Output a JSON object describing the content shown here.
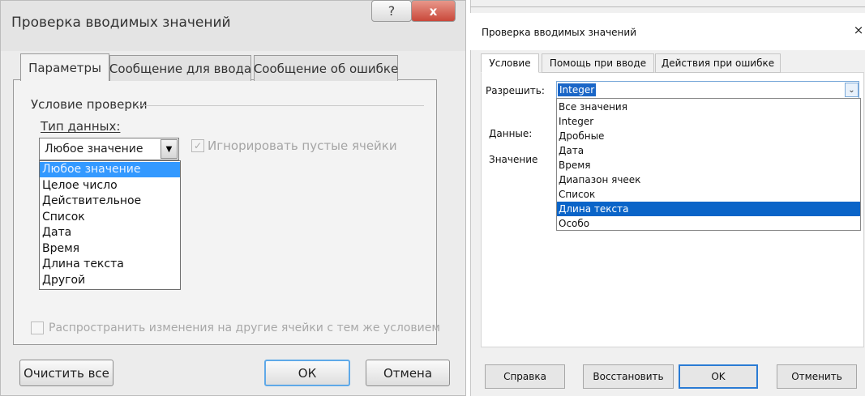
{
  "left_dialog": {
    "title": "Проверка вводимых значений",
    "help_icon": "?",
    "close_icon": "x",
    "tabs": [
      {
        "label": "Параметры"
      },
      {
        "label": "Сообщение для ввода"
      },
      {
        "label": "Сообщение об ошибке"
      }
    ],
    "group_title": "Условие проверки",
    "data_type_label": "Тип данных:",
    "data_type_value": "Любое значение",
    "ignore_blank_label": "Игнорировать пустые ячейки",
    "options": [
      {
        "label": "Любое значение"
      },
      {
        "label": "Целое число"
      },
      {
        "label": "Действительное"
      },
      {
        "label": "Список"
      },
      {
        "label": "Дата"
      },
      {
        "label": "Время"
      },
      {
        "label": "Длина текста"
      },
      {
        "label": "Другой"
      }
    ],
    "selected_option": "Любое значение",
    "spread_changes_label": "Распространить изменения на другие ячейки с тем же условием",
    "buttons": {
      "clear": "Очистить все",
      "ok": "ОК",
      "cancel": "Отмена"
    }
  },
  "right_dialog": {
    "title": "Проверка вводимых значений",
    "close_icon": "×",
    "tabs": [
      {
        "label": "Условие"
      },
      {
        "label": "Помощь при вводе"
      },
      {
        "label": "Действия при ошибке"
      }
    ],
    "allow_label": "Разрешить:",
    "allow_value": "Integer",
    "data_label": "Данные:",
    "value_label": "Значение",
    "options": [
      {
        "label": "Все значения"
      },
      {
        "label": "Integer"
      },
      {
        "label": "Дробные"
      },
      {
        "label": "Дата"
      },
      {
        "label": "Время"
      },
      {
        "label": "Диапазон ячеек"
      },
      {
        "label": "Список"
      },
      {
        "label": "Длина текста"
      },
      {
        "label": "Особо"
      }
    ],
    "selected_option": "Длина текста",
    "buttons": {
      "help": "Справка",
      "reset": "Восстановить",
      "ok": "OK",
      "cancel": "Отменить"
    }
  },
  "colors": {
    "left_selection": "#3399ff",
    "right_selection": "#0a64c8",
    "left_close_button": "#c9483a"
  }
}
